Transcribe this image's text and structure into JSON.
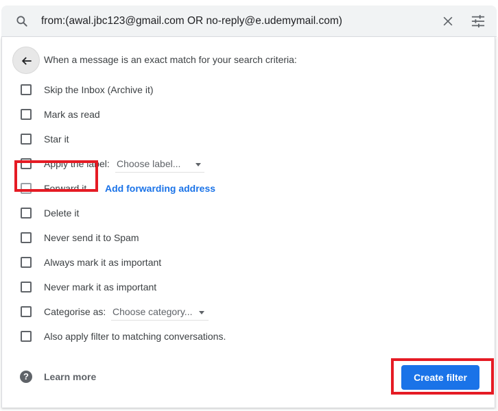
{
  "search": {
    "query": "from:(awal.jbc123@gmail.com OR no-reply@e.udemymail.com)",
    "search_icon": "search-icon",
    "clear_icon": "close-icon",
    "options_icon": "tune-icon"
  },
  "filter_panel": {
    "back_icon": "arrow-back-icon",
    "heading": "When a message is an exact match for your search criteria:",
    "options": [
      {
        "label": "Skip the Inbox (Archive it)",
        "checked": false
      },
      {
        "label": "Mark as read",
        "checked": false
      },
      {
        "label": "Star it",
        "checked": false
      },
      {
        "label": "Apply the label:",
        "checked": false,
        "select_value": "Choose label..."
      },
      {
        "label": "Forward it",
        "checked": false,
        "link": "Add forwarding address"
      },
      {
        "label": "Delete it",
        "checked": false
      },
      {
        "label": "Never send it to Spam",
        "checked": false
      },
      {
        "label": "Always mark it as important",
        "checked": false
      },
      {
        "label": "Never mark it as important",
        "checked": false
      },
      {
        "label": "Categorise as:",
        "checked": false,
        "select_value": "Choose category..."
      },
      {
        "label": "Also apply filter to matching conversations.",
        "checked": false
      }
    ],
    "learn_more": "Learn more",
    "help_icon_glyph": "?",
    "create_button": "Create filter"
  },
  "colors": {
    "accent": "#1a73e8",
    "highlight": "#e51b24"
  }
}
